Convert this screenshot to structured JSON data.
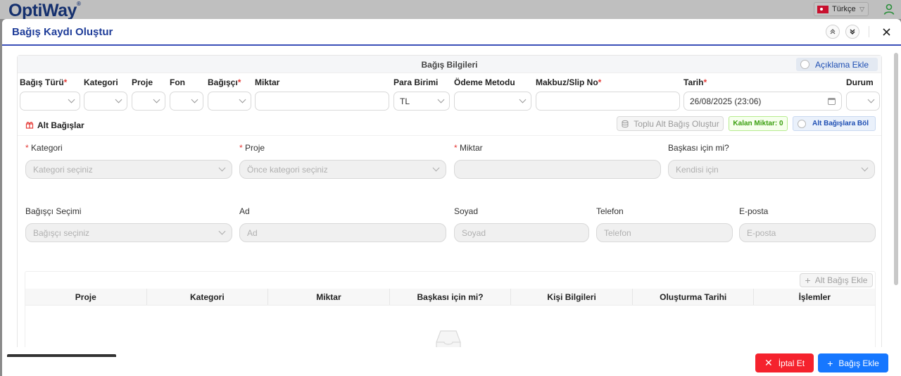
{
  "app": {
    "logo": "OptiWay",
    "language": "Türkçe",
    "brand_color": "#15306e"
  },
  "modal": {
    "title": "Bağış Kaydı Oluştur"
  },
  "donation_info": {
    "title": "Bağış Bilgileri",
    "description_toggle": "Açıklama Ekle",
    "fields": {
      "type": "Bağış Türü",
      "category": "Kategori",
      "project": "Proje",
      "fund": "Fon",
      "donor": "Bağışçı",
      "amount": "Miktar",
      "currency": "Para Birimi",
      "payment": "Ödeme Metodu",
      "receipt": "Makbuz/Slip No",
      "date": "Tarih",
      "status": "Durum"
    },
    "values": {
      "currency": "TL",
      "date": "26/08/2025 (23:06)"
    }
  },
  "sub_donations": {
    "title": "Alt Bağışlar",
    "bulk_button": "Toplu Alt Bağış Oluştur",
    "remaining": "Kalan Miktar: 0",
    "split_toggle": "Alt Bağışlara Böl",
    "form": {
      "category_label": "Kategori",
      "category_placeholder": "Kategori seçiniz",
      "project_label": "Proje",
      "project_placeholder": "Önce kategori seçiniz",
      "amount_label": "Miktar",
      "other_label": "Başkası için mi?",
      "other_value": "Kendisi için",
      "donor_label": "Bağışçı Seçimi",
      "donor_placeholder": "Bağışçı seçiniz",
      "name_label": "Ad",
      "name_placeholder": "Ad",
      "surname_label": "Soyad",
      "surname_placeholder": "Soyad",
      "phone_label": "Telefon",
      "phone_placeholder": "Telefon",
      "email_label": "E-posta",
      "email_placeholder": "E-posta"
    },
    "add_button": "Alt Bağış Ekle",
    "columns": [
      "Proje",
      "Kategori",
      "Miktar",
      "Başkası için mi?",
      "Kişi Bilgileri",
      "Oluşturma Tarihi",
      "İşlemler"
    ]
  },
  "footer": {
    "cancel": "İptal Et",
    "submit": "Bağış Ekle"
  }
}
